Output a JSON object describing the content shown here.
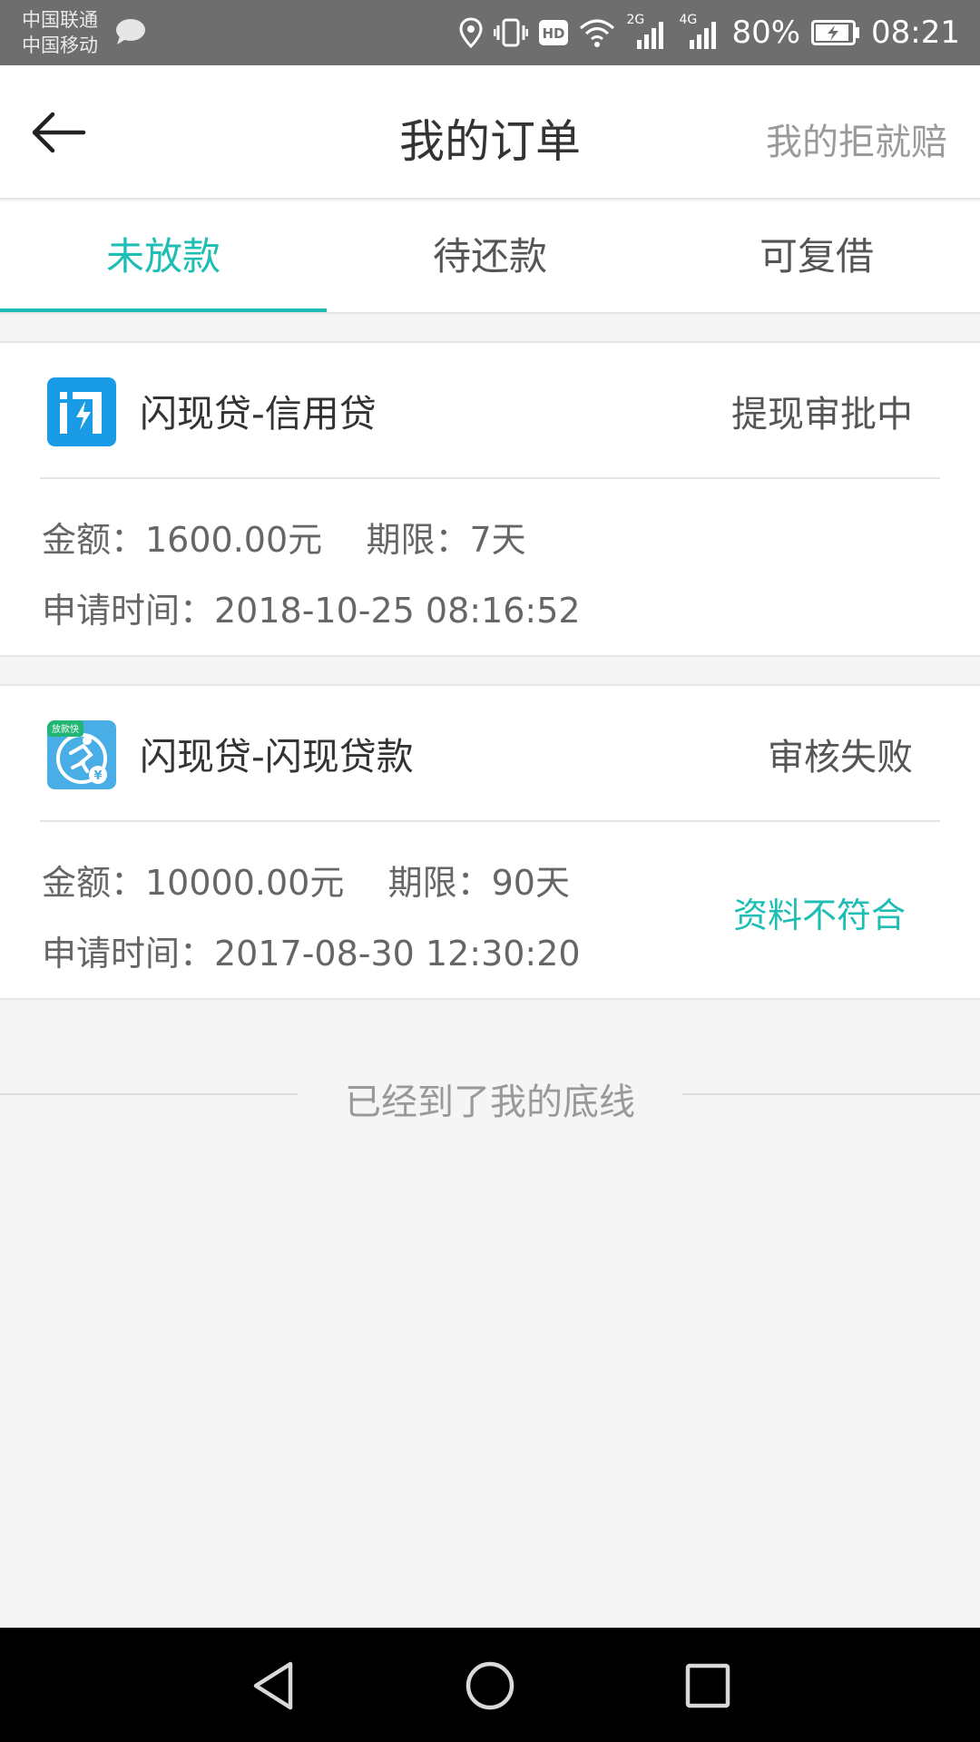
{
  "status_bar": {
    "carrier_1": "中国联通",
    "carrier_2": "中国移动",
    "network_2g": "2G",
    "network_4g": "4G",
    "battery": "80%",
    "time": "08:21",
    "hd": "HD"
  },
  "header": {
    "title": "我的订单",
    "right_link": "我的拒就赔"
  },
  "tabs": [
    {
      "label": "未放款",
      "active": true
    },
    {
      "label": "待还款",
      "active": false
    },
    {
      "label": "可复借",
      "active": false
    }
  ],
  "orders": [
    {
      "product": "闪现贷-信用贷",
      "status": "提现审批中",
      "amount_line": "金额：1600.00元    期限：7天",
      "apply_time": "申请时间：2018-10-25 08:16:52",
      "reason": ""
    },
    {
      "product": "闪现贷-闪现贷款",
      "status": "审核失败",
      "amount_line": "金额：10000.00元    期限：90天",
      "apply_time": "申请时间：2017-08-30 12:30:20",
      "reason": "资料不符合",
      "icon_badge": "放款快",
      "icon_currency": "¥"
    }
  ],
  "end_of_list": "已经到了我的底线",
  "colors": {
    "accent": "#1ebeb4",
    "status_bar": "#6e6e6e",
    "icon_blue": "#1a9be6"
  }
}
